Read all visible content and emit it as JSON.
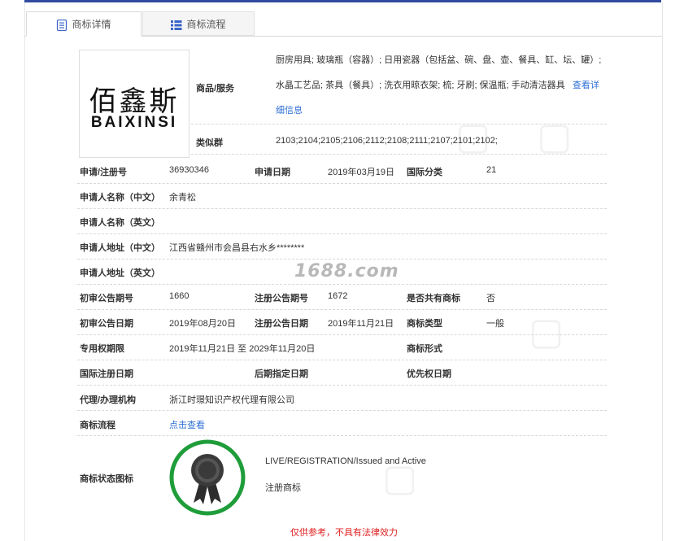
{
  "tabs": {
    "detail": "商标详情",
    "flow": "商标流程"
  },
  "logo": {
    "cn": "佰鑫斯",
    "en": "BAIXINSI"
  },
  "goods": {
    "label": "商品/服务",
    "line1": "厨房用具; 玻璃瓶（容器）; 日用瓷器（包括盆、碗、盘、壶、餐具、缸、坛、罐）;",
    "line2": "水晶工艺品; 茶具（餐具）; 洗衣用晾衣架; 梳; 牙刷; 保温瓶; 手动清洁器具",
    "more_link": "查看详",
    "more_link2": "细信息"
  },
  "similar": {
    "label": "类似群",
    "value": "2103;2104;2105;2106;2112;2108;2111;2107;2101;2102;"
  },
  "rows": {
    "reg_no_label": "申请/注册号",
    "reg_no": "36930346",
    "app_date_label": "申请日期",
    "app_date": "2019年03月19日",
    "intl_class_label": "国际分类",
    "intl_class": "21",
    "applicant_cn_label": "申请人名称（中文）",
    "applicant_cn": "余青松",
    "applicant_en_label": "申请人名称（英文）",
    "address_cn_label": "申请人地址（中文）",
    "address_cn": "江西省赣州市会昌县右水乡********",
    "address_en_label": "申请人地址（英文）",
    "prelim_no_label": "初审公告期号",
    "prelim_no": "1660",
    "reg_pub_no_label": "注册公告期号",
    "reg_pub_no": "1672",
    "shared_label": "是否共有商标",
    "shared": "否",
    "prelim_date_label": "初审公告日期",
    "prelim_date": "2019年08月20日",
    "reg_pub_date_label": "注册公告日期",
    "reg_pub_date": "2019年11月21日",
    "tm_type_label": "商标类型",
    "tm_type": "一般",
    "excl_period_label": "专用权期限",
    "excl_period": "2019年11月21日 至 2029年11月20日",
    "tm_form_label": "商标形式",
    "intl_reg_date_label": "国际注册日期",
    "later_date_label": "后期指定日期",
    "priority_date_label": "优先权日期",
    "agent_label": "代理/办理机构",
    "agent": "浙江时璟知识产权代理有限公司",
    "flow_label": "商标流程",
    "flow_link": "点击查看",
    "status_icon_label": "商标状态图标",
    "status_en": "LIVE/REGISTRATION/Issued and Active",
    "status_cn": "注册商标"
  },
  "watermark": "1688.com",
  "disclaimer": "仅供参考，不具有法律效力",
  "colors": {
    "accent": "#2f4a9e",
    "link": "#2f6fd6",
    "seal_ring": "#1f9d3a",
    "disclaimer": "#e02020"
  }
}
